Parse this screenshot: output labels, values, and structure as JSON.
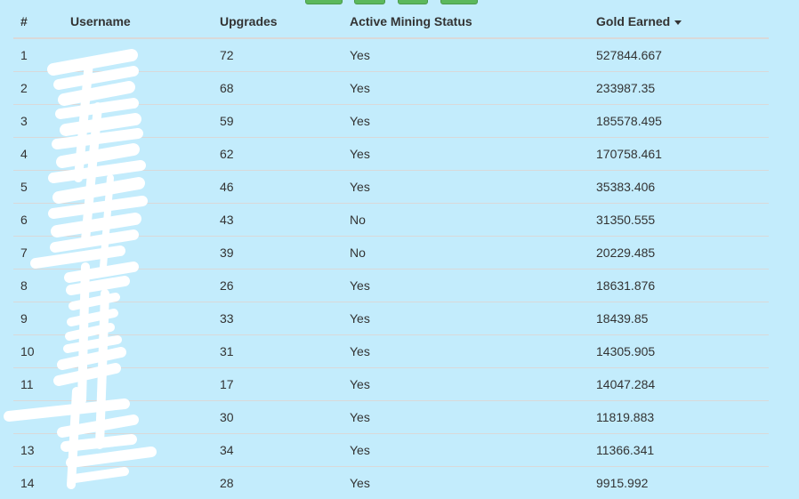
{
  "table": {
    "headers": {
      "rank": "#",
      "username": "Username",
      "upgrades": "Upgrades",
      "status": "Active Mining Status",
      "gold": "Gold Earned"
    },
    "sort": {
      "column": "gold",
      "direction": "descending",
      "icon": "caret-down-icon"
    },
    "rows": [
      {
        "rank": "1",
        "username": "",
        "upgrades": "72",
        "status": "Yes",
        "gold": "527844.667"
      },
      {
        "rank": "2",
        "username": "",
        "upgrades": "68",
        "status": "Yes",
        "gold": "233987.35"
      },
      {
        "rank": "3",
        "username": "",
        "upgrades": "59",
        "status": "Yes",
        "gold": "185578.495"
      },
      {
        "rank": "4",
        "username": "",
        "upgrades": "62",
        "status": "Yes",
        "gold": "170758.461"
      },
      {
        "rank": "5",
        "username": "",
        "upgrades": "46",
        "status": "Yes",
        "gold": "35383.406"
      },
      {
        "rank": "6",
        "username": "",
        "upgrades": "43",
        "status": "No",
        "gold": "31350.555"
      },
      {
        "rank": "7",
        "username": "",
        "upgrades": "39",
        "status": "No",
        "gold": "20229.485"
      },
      {
        "rank": "8",
        "username": "",
        "upgrades": "26",
        "status": "Yes",
        "gold": "18631.876"
      },
      {
        "rank": "9",
        "username": "",
        "upgrades": "33",
        "status": "Yes",
        "gold": "18439.85"
      },
      {
        "rank": "10",
        "username": "",
        "upgrades": "31",
        "status": "Yes",
        "gold": "14305.905"
      },
      {
        "rank": "11",
        "username": "",
        "upgrades": "17",
        "status": "Yes",
        "gold": "14047.284"
      },
      {
        "rank": "",
        "username": "",
        "upgrades": "30",
        "status": "Yes",
        "gold": "11819.883"
      },
      {
        "rank": "13",
        "username": "",
        "upgrades": "34",
        "status": "Yes",
        "gold": "11366.341"
      },
      {
        "rank": "14",
        "username": "",
        "upgrades": "28",
        "status": "Yes",
        "gold": "9915.992"
      }
    ]
  },
  "colors": {
    "background": "#c3ecfc",
    "button_green": "#5cb85c",
    "row_border": "#d9d9d9",
    "redaction": "#ffffff"
  }
}
